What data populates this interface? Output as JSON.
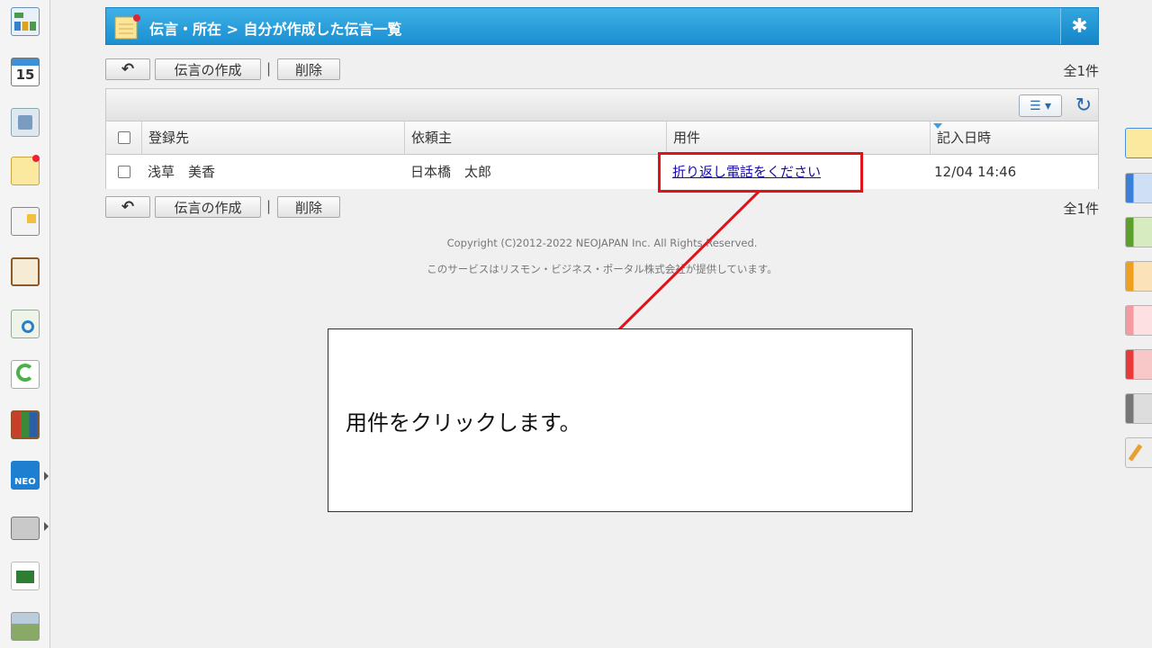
{
  "header": {
    "title": "伝言・所在 > 自分が作成した伝言一覧",
    "gear_icon": "gear-icon"
  },
  "toolbar": {
    "back_icon": "back-arrow-icon",
    "create_label": "伝言の作成",
    "delete_label": "削除",
    "separator": "|",
    "count": "全1件"
  },
  "table": {
    "columns": [
      "登録先",
      "依頼主",
      "用件",
      "記入日時"
    ],
    "rows": [
      {
        "recipient": "浅草　美香",
        "requester": "日本橋　太郎",
        "subject": "折り返し電話をください",
        "datetime": "12/04 14:46"
      }
    ],
    "menu_icon": "list-menu-icon",
    "refresh_icon": "refresh-icon"
  },
  "footer": {
    "copyright": "Copyright (C)2012-2022 NEOJAPAN Inc. All Rights Reserved.",
    "provider": "このサービスはリスモン・ビジネス・ポータル株式会社が提供しています。"
  },
  "annotation": {
    "text": "用件をクリックします。",
    "color": "#e0131b"
  },
  "colors": {
    "header": "#1a8fd1",
    "link": "#1a0dab"
  }
}
